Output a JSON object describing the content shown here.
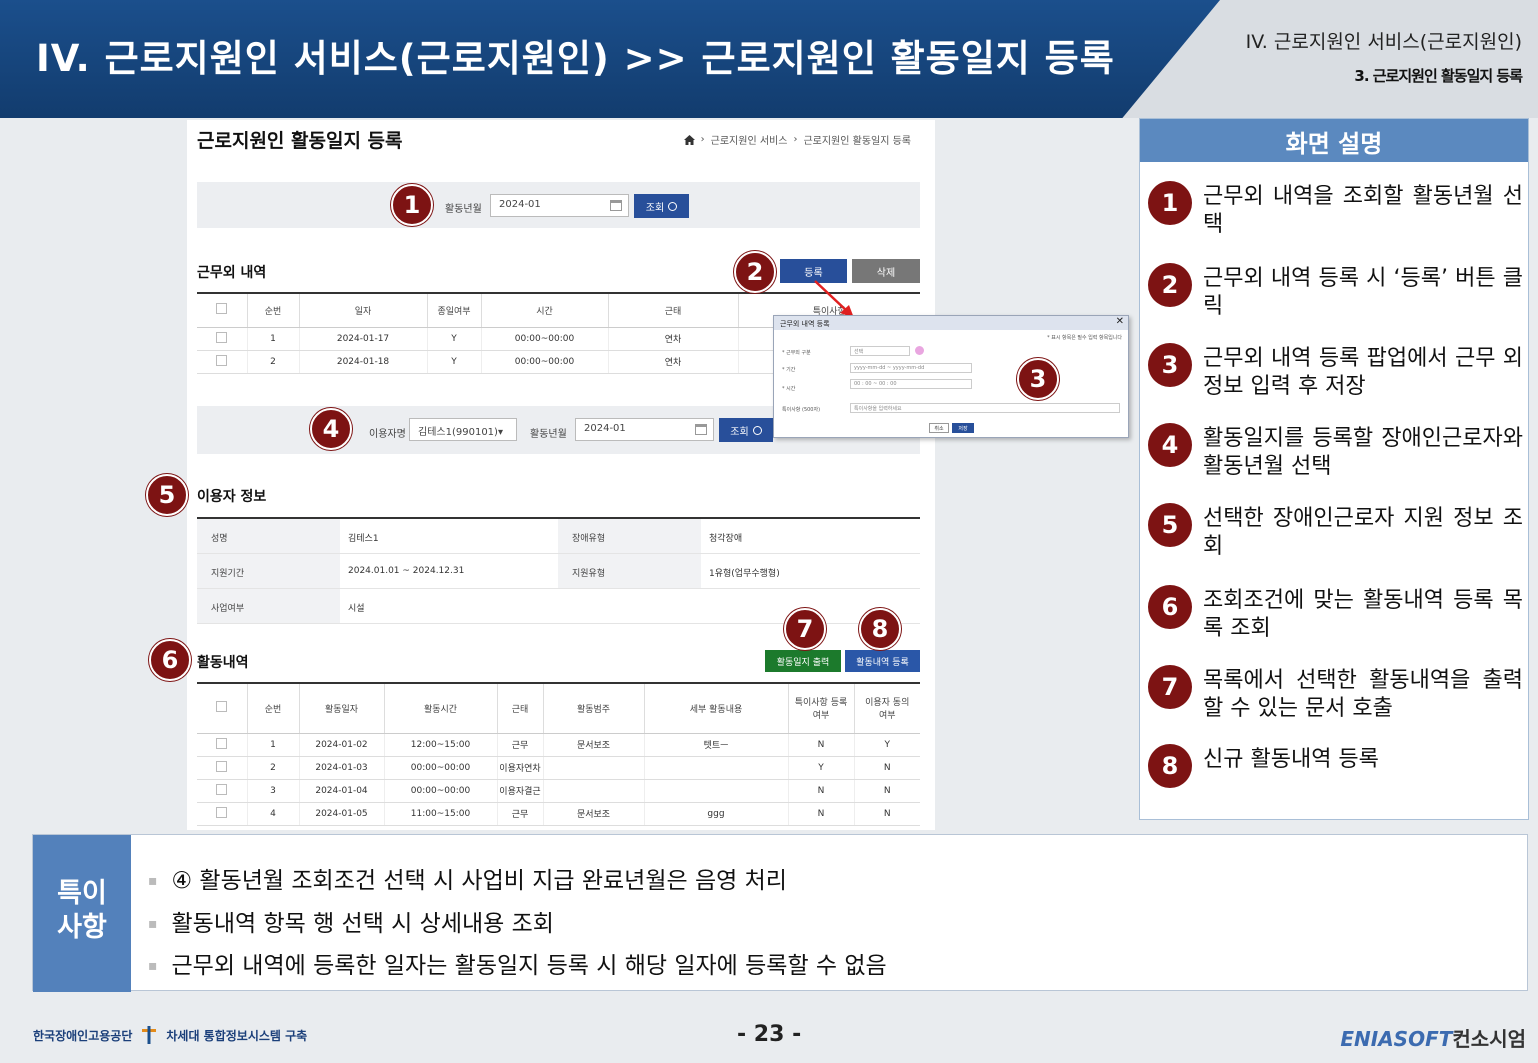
{
  "header": {
    "title": "IV. 근로지원인 서비스(근로지원인) >> 근로지원인 활동일지 등록",
    "section": "IV. 근로지원인 서비스(근로지원인)",
    "subsection": "3. 근로지원인 활동일지 등록"
  },
  "screen": {
    "title": "근로지원인 활동일지 등록",
    "breadcrumb": [
      "근로지원인 서비스",
      "근로지원인 활동일지 등록"
    ],
    "search1": {
      "label": "활동년월",
      "value": "2024-01",
      "button": "조회"
    },
    "offwork": {
      "title": "근무외 내역",
      "register_btn": "등록",
      "delete_btn": "삭제",
      "columns": [
        "순번",
        "일자",
        "종일여부",
        "시간",
        "근태",
        "특이사항"
      ],
      "rows": [
        [
          "1",
          "2024-01-17",
          "Y",
          "00:00~00:00",
          "연차",
          ""
        ],
        [
          "2",
          "2024-01-18",
          "Y",
          "00:00~00:00",
          "연차",
          ""
        ]
      ]
    },
    "search2": {
      "user_label": "이용자명",
      "user_value": "김테스1(990101)",
      "month_label": "활동년월",
      "month_value": "2024-01",
      "button": "조회"
    },
    "userinfo": {
      "title": "이용자 정보",
      "rows": [
        [
          {
            "k": "성명",
            "v": "김테스1"
          },
          {
            "k": "장애유형",
            "v": "청각장애"
          }
        ],
        [
          {
            "k": "지원기간",
            "v": "2024.01.01 ~ 2024.12.31"
          },
          {
            "k": "지원유형",
            "v": "1유형(업무수행형)"
          }
        ],
        [
          {
            "k": "사업여부",
            "v": "시설"
          }
        ]
      ]
    },
    "activity": {
      "title": "활동내역",
      "print_btn": "활동일지 출력",
      "register_btn": "활동내역 등록",
      "columns": [
        "순번",
        "활동일자",
        "활동시간",
        "근태",
        "활동범주",
        "세부 활동내용",
        "특이사항 등록여부",
        "이용자 동의여부"
      ],
      "rows": [
        [
          "1",
          "2024-01-02",
          "12:00~15:00",
          "근무",
          "문서보조",
          "텟트ㅡ",
          "N",
          "Y"
        ],
        [
          "2",
          "2024-01-03",
          "00:00~00:00",
          "이용자연차",
          "",
          "",
          "Y",
          "N"
        ],
        [
          "3",
          "2024-01-04",
          "00:00~00:00",
          "이용자결근",
          "",
          "",
          "N",
          "N"
        ],
        [
          "4",
          "2024-01-05",
          "11:00~15:00",
          "근무",
          "문서보조",
          "ggg",
          "N",
          "N"
        ]
      ]
    },
    "popup": {
      "title": "근무외 내역 등록",
      "hint": "* 표시 항목은 필수 입력 항목입니다",
      "fields": [
        {
          "label": "* 근무외 구분",
          "value": "선택"
        },
        {
          "label": "* 기간",
          "value": "yyyy-mm-dd ~ yyyy-mm-dd"
        },
        {
          "label": "* 시간",
          "value": "00 : 00 ~ 00 : 00"
        },
        {
          "label": "특이사항 (500자)",
          "value": "특이사항을 입력하세요"
        }
      ],
      "cancel": "취소",
      "save": "저장"
    }
  },
  "badges": [
    "1",
    "2",
    "3",
    "4",
    "5",
    "6",
    "7",
    "8"
  ],
  "description": {
    "title": "화면 설명",
    "items": [
      "근무외 내역을 조회할 활동년월 선택",
      "근무외 내역 등록 시 ‘등록’ 버튼 클릭",
      "근무외 내역 등록 팝업에서 근무 외 정보 입력 후 저장",
      "활동일지를 등록할 장애인근로자와 활동년월 선택",
      "선택한 장애인근로자 지원 정보 조회",
      "조회조건에 맞는 활동내역 등록 목록 조회",
      "목록에서 선택한 활동내역을 출력할 수 있는 문서 호출",
      "신규 활동내역 등록"
    ]
  },
  "notes": {
    "tag": "특이사항",
    "items": [
      "④ 활동년월 조회조건 선택 시 사업비 지급 완료년월은 음영 처리",
      "활동내역 항목 행 선택 시 상세내용 조회",
      "근무외 내역에 등록한 일자는 활동일지 등록 시 해당 일자에 등록할 수 없음"
    ]
  },
  "footer": {
    "org": "한국장애인고용공단",
    "project": "차세대 통합정보시스템 구축",
    "page": "- 23 -",
    "vendor_en": "ENIASOFT",
    "vendor_ko": "컨소시엄"
  },
  "colors": {
    "banner": "#1b4f8c",
    "badge": "#7d1313",
    "primary_btn": "#284f9a",
    "accent": "#5b89bf"
  }
}
